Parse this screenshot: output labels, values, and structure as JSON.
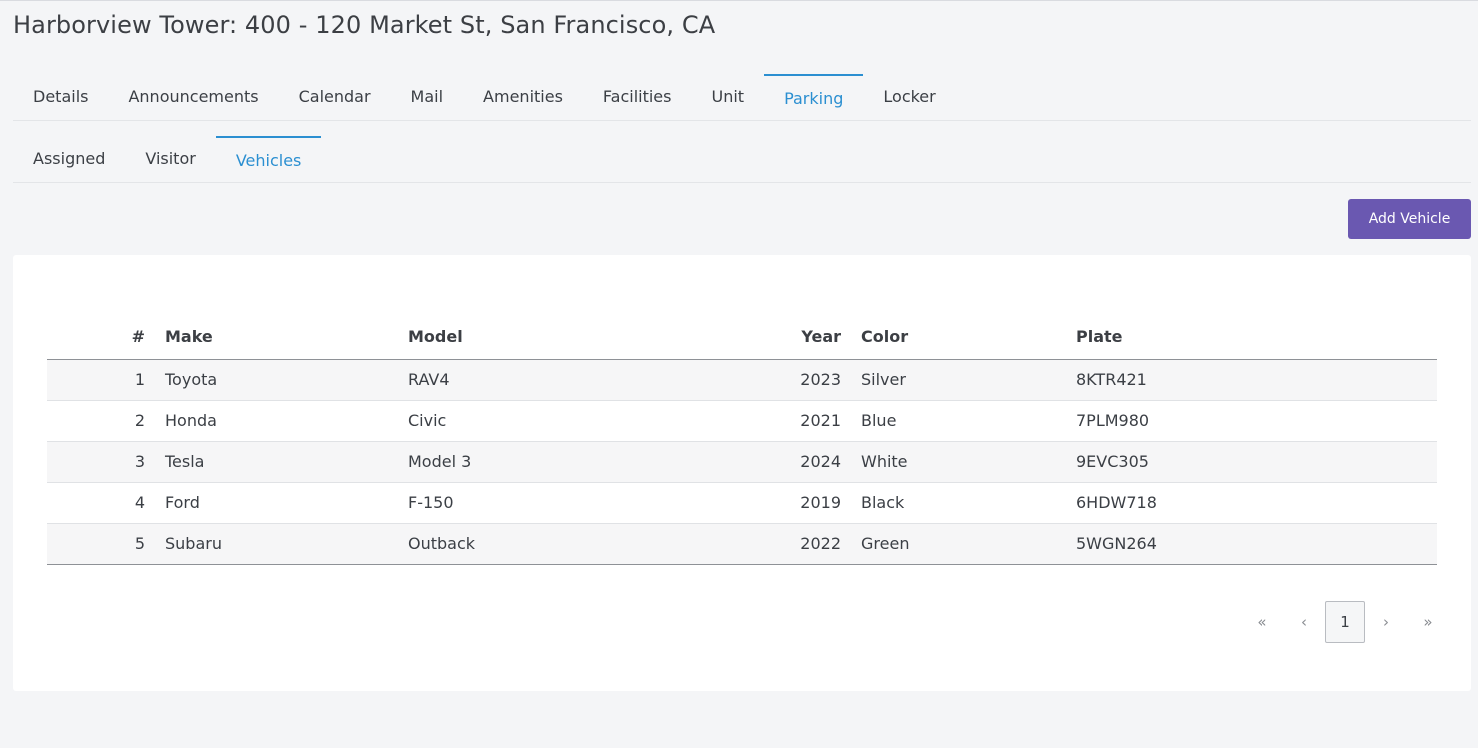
{
  "page": {
    "title": "Harborview Tower: 400 - 120 Market St, San Francisco, CA"
  },
  "main_tabs": [
    {
      "label": "Details",
      "active": false
    },
    {
      "label": "Announcements",
      "active": false
    },
    {
      "label": "Calendar",
      "active": false
    },
    {
      "label": "Mail",
      "active": false
    },
    {
      "label": "Amenities",
      "active": false
    },
    {
      "label": "Facilities",
      "active": false
    },
    {
      "label": "Unit",
      "active": false
    },
    {
      "label": "Parking",
      "active": true
    },
    {
      "label": "Locker",
      "active": false
    }
  ],
  "sub_tabs": [
    {
      "label": "Assigned",
      "active": false
    },
    {
      "label": "Visitor",
      "active": false
    },
    {
      "label": "Vehicles",
      "active": true
    }
  ],
  "toolbar": {
    "add_label": "Add Vehicle"
  },
  "table": {
    "headers": {
      "num": "#",
      "make": "Make",
      "model": "Model",
      "year": "Year",
      "color": "Color",
      "plate": "Plate"
    },
    "rows": [
      {
        "num": "1",
        "make": "Toyota",
        "model": "RAV4",
        "year": "2023",
        "color": "Silver",
        "plate": "8KTR421"
      },
      {
        "num": "2",
        "make": "Honda",
        "model": "Civic",
        "year": "2021",
        "color": "Blue",
        "plate": "7PLM980"
      },
      {
        "num": "3",
        "make": "Tesla",
        "model": "Model 3",
        "year": "2024",
        "color": "White",
        "plate": "9EVC305"
      },
      {
        "num": "4",
        "make": "Ford",
        "model": "F-150",
        "year": "2019",
        "color": "Black",
        "plate": "6HDW718"
      },
      {
        "num": "5",
        "make": "Subaru",
        "model": "Outback",
        "year": "2022",
        "color": "Green",
        "plate": "5WGN264"
      }
    ]
  },
  "pagination": {
    "first": "«",
    "prev": "‹",
    "current": "1",
    "next": "›",
    "last": "»"
  },
  "colors": {
    "accent": "#2b8fd1",
    "button": "#6a58b1"
  }
}
